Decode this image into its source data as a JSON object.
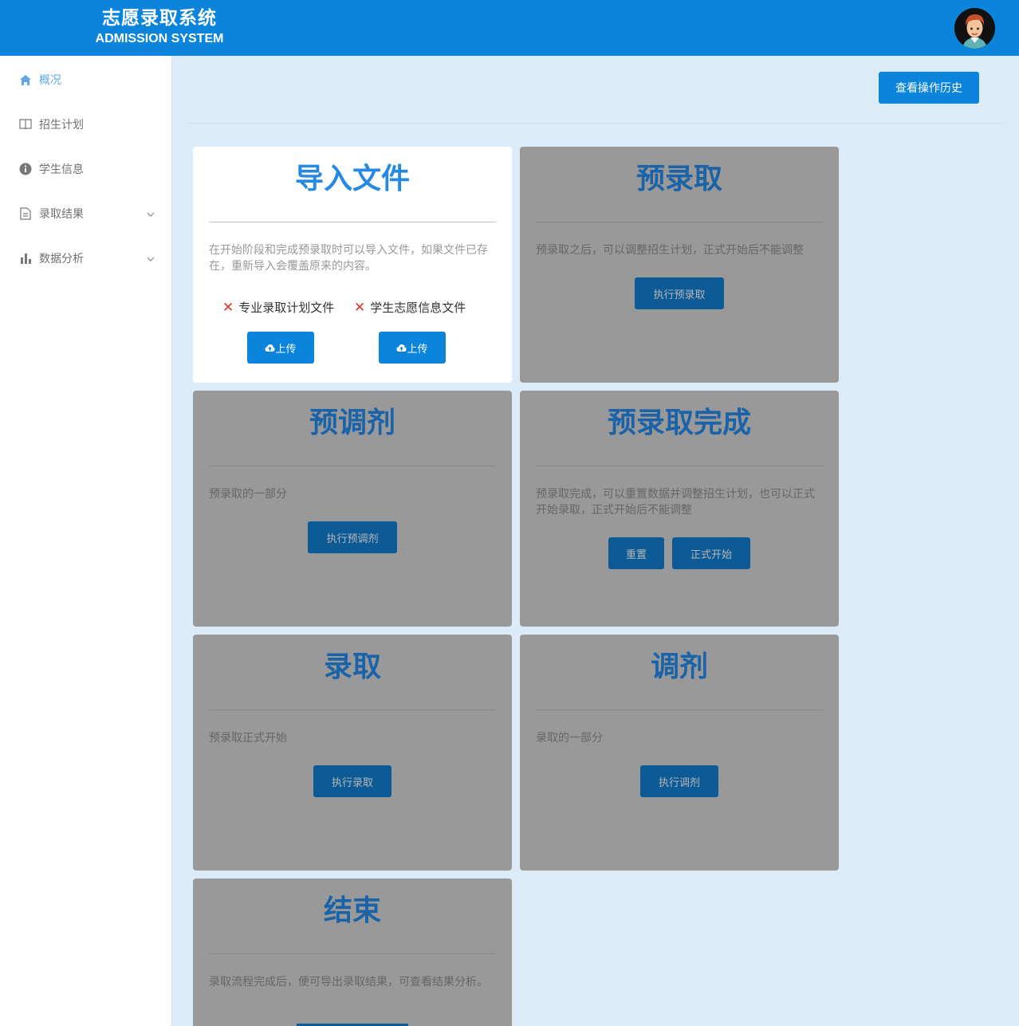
{
  "header": {
    "title_cn": "志愿录取系统",
    "title_en": "ADMISSION SYSTEM",
    "avatar_icon": "user-avatar",
    "bg_color": "#0b84db"
  },
  "sidebar": {
    "items": [
      {
        "label": "概况",
        "icon": "home-icon",
        "active": true
      },
      {
        "label": "招生计划",
        "icon": "book-icon"
      },
      {
        "label": "学生信息",
        "icon": "info-icon"
      },
      {
        "label": "录取结果",
        "icon": "document-icon",
        "expandable": true
      },
      {
        "label": "数据分析",
        "icon": "bar-chart-icon",
        "expandable": true
      }
    ]
  },
  "toolbar": {
    "history_label": "查看操作历史"
  },
  "cards": {
    "import": {
      "title": "导入文件",
      "desc": "在开始阶段和完成预录取时可以导入文件，如果文件已存在，重新导入会覆盖原来的内容。",
      "file1_label": "专业录取计划文件",
      "file2_label": "学生志愿信息文件",
      "upload_label": "上传"
    },
    "pre_admit": {
      "title": "预录取",
      "desc": "预录取之后，可以调整招生计划，正式开始后不能调整",
      "button": "执行预录取"
    },
    "pre_adjust": {
      "title": "预调剂",
      "desc": "预录取的一部分",
      "button": "执行预调剂"
    },
    "pre_done": {
      "title": "预录取完成",
      "desc": "预录取完成，可以重置数据并调整招生计划，也可以正式开始录取，正式开始后不能调整",
      "button_reset": "重置",
      "button_start": "正式开始"
    },
    "admit": {
      "title": "录取",
      "desc": "预录取正式开始",
      "button": "执行录取"
    },
    "adjust": {
      "title": "调剂",
      "desc": "录取的一部分",
      "button": "执行调剂"
    },
    "finish": {
      "title": "结束",
      "desc": "录取流程完成后，便可导出录取结果，可查看结果分析。"
    }
  }
}
